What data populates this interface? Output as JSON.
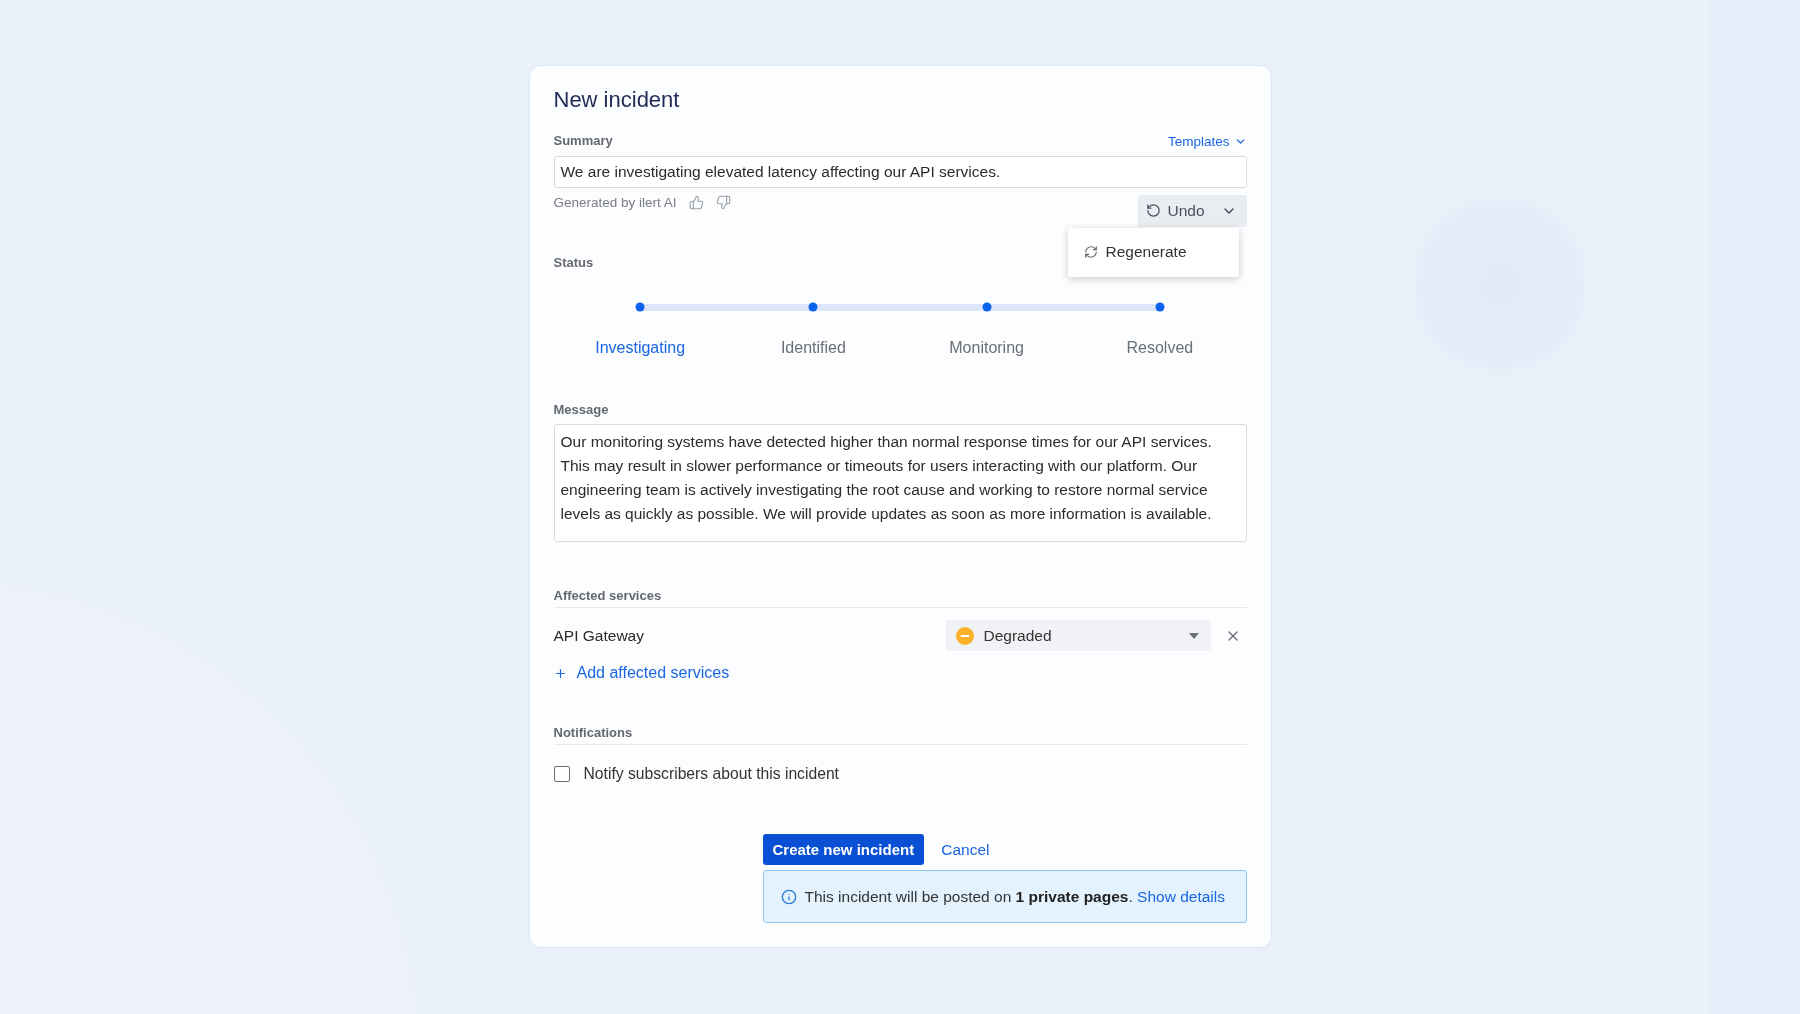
{
  "dialog": {
    "title": "New incident"
  },
  "summary": {
    "label": "Summary",
    "templates_link": "Templates",
    "value": "We are investigating elevated latency affecting our API services.",
    "ai_note": "Generated by ilert AI",
    "undo_button": "Undo",
    "menu": {
      "open": true,
      "items": [
        {
          "label": "Regenerate"
        }
      ]
    }
  },
  "status": {
    "label": "Status",
    "steps": [
      {
        "label": "Investigating",
        "selected": true
      },
      {
        "label": "Identified",
        "selected": false
      },
      {
        "label": "Monitoring",
        "selected": false
      },
      {
        "label": "Resolved",
        "selected": false
      }
    ]
  },
  "message": {
    "label": "Message",
    "value": "Our monitoring systems have detected higher than normal response times for our API services. This may result in slower performance or timeouts for users interacting with our platform. Our engineering team is actively investigating the root cause and working to restore normal service levels as quickly as possible. We will provide updates as soon as more information is available."
  },
  "affected_services": {
    "label": "Affected services",
    "items": [
      {
        "name": "API Gateway",
        "status": "Degraded",
        "color": "#fbb22b"
      }
    ],
    "add_link": "Add affected services"
  },
  "notifications": {
    "label": "Notifications",
    "options": [
      {
        "label": "Notify subscribers about this incident",
        "checked": false
      }
    ]
  },
  "actions": {
    "create_button": "Create new incident",
    "cancel_link": "Cancel"
  },
  "info": {
    "text": "This incident will be posted on **1 private pages**.",
    "link": "Show details"
  }
}
